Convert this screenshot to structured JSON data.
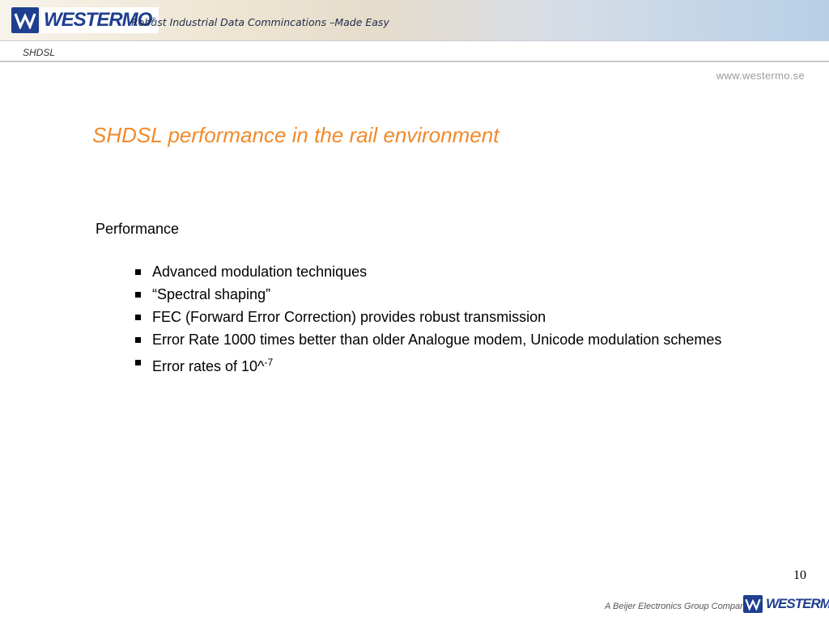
{
  "header": {
    "brand": "WESTERMO",
    "tagline": "Robust Industrial Data Commincations –Made Easy",
    "section": "SHDSL",
    "url": "www.westermo.se"
  },
  "slide": {
    "title": "SHDSL performance in the rail environment",
    "subheading": "Performance",
    "bullets": [
      "Advanced modulation techniques",
      "“Spectral shaping”",
      "FEC (Forward Error Correction) provides robust transmission",
      "Error Rate 1000 times better than older Analogue modem, Unicode modulation schemes"
    ],
    "last_bullet": {
      "text": "Error rates of 10^",
      "superscript": "-7"
    },
    "page_number": "10"
  },
  "footer": {
    "company": "A Beijer Electronics Group Company",
    "brand": "WESTERMO"
  },
  "colors": {
    "title": "#f08a2a",
    "brand_blue": "#1f3f8f"
  }
}
